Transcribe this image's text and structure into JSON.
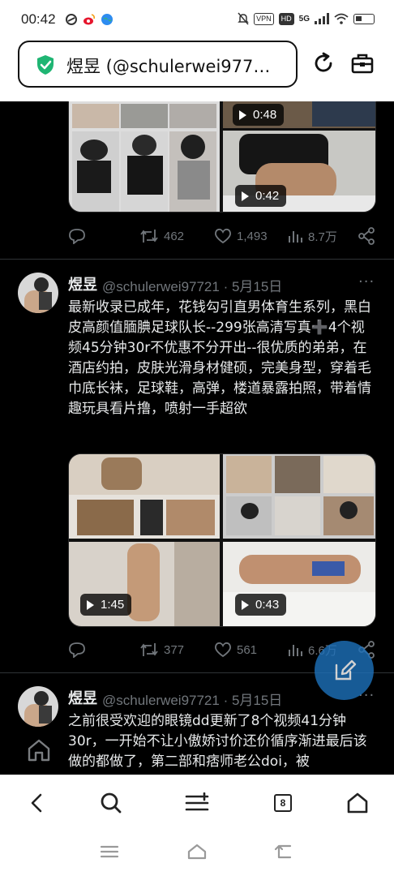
{
  "status_bar": {
    "time": "00:42",
    "vpn_label": "VPN",
    "hd_label": "HD",
    "network_label": "5G"
  },
  "browser": {
    "url_text": "煜昱 (@schulerwei977…",
    "tab_count": "8",
    "accent_color": "#1fb573"
  },
  "feed": {
    "tweet0": {
      "videos": [
        {
          "duration": "0:48"
        },
        {
          "duration": "0:42"
        }
      ],
      "actions": {
        "retweets": "462",
        "likes": "1,493",
        "views": "8.7万"
      }
    },
    "tweet1": {
      "name": "煜昱",
      "handle_date": "@schulerwei97721 · 5月15日",
      "more": "···",
      "text": "最新收录已成年，花钱勾引直男体育生系列，黑白皮高颜值腼腆足球队长--299张高清写真➕4个视频45分钟30r不优惠不分开出--很优质的弟弟，在酒店约拍，皮肤光滑身材健硕，完美身型，穿着毛巾底长袜，足球鞋，高弹，楼道暴露拍照，带着情趣玩具看片撸，喷射一手超欲",
      "videos": [
        {
          "duration": "1:45"
        },
        {
          "duration": "0:43"
        }
      ],
      "actions": {
        "retweets": "377",
        "likes": "561",
        "views": "6.6万"
      }
    },
    "tweet2": {
      "name": "煜昱",
      "handle_date": "@schulerwei97721 · 5月15日",
      "more": "···",
      "text": "之前很受欢迎的眼镜dd更新了8个视频41分钟30r，一开始不让小傲娇讨价还价循序渐进最后该做的都做了，第二部和痞师老公doi，被"
    }
  }
}
